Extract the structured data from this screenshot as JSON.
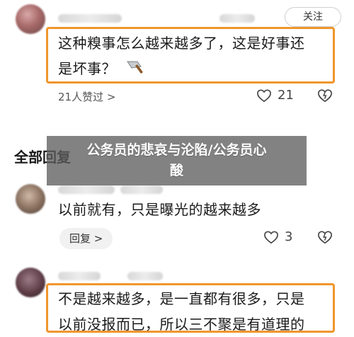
{
  "comment1": {
    "follow_label": "关注",
    "text_line1": "这种糗事怎么越来越多了，这是好事还",
    "text_line2": "是坏事？",
    "emoji": "🔪",
    "likes_meta": "21人赞过 >",
    "like_count": "21"
  },
  "section": {
    "heading": "全部回复"
  },
  "overlay": {
    "title_line1": "公务员的悲哀与沦陷/公务员心",
    "title_line2": "酸"
  },
  "comment2": {
    "text": "以前就有，只是曝光的越来越多",
    "reply_label": "回复 >",
    "like_count": "3"
  },
  "comment3": {
    "text_line1": "不是越来越多，是一直都有很多，只是",
    "text_line2": "以前没报而已，所以三不聚是有道理的"
  },
  "icons": {
    "heart": "heart-icon",
    "dislike": "dislike-icon",
    "knife": "knife-emoji"
  },
  "colors": {
    "highlight": "#f0962c",
    "overlay": "#5f5f5f"
  }
}
